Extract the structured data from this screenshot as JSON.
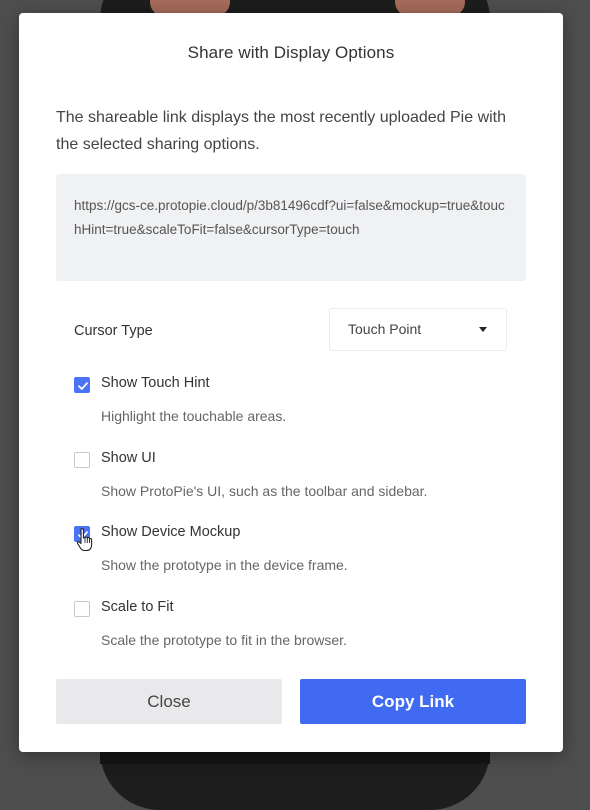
{
  "dialog": {
    "title": "Share with Display Options",
    "description": "The shareable link displays the most recently uploaded Pie with the selected sharing options.",
    "share_url": "https://gcs-ce.protopie.cloud/p/3b81496cdf?ui=false&mockup=true&touchHint=true&scaleToFit=false&cursorType=touch"
  },
  "cursor_type": {
    "label": "Cursor Type",
    "selected": "Touch Point"
  },
  "options": [
    {
      "label": "Show Touch Hint",
      "description": "Highlight the touchable areas.",
      "checked": true
    },
    {
      "label": "Show UI",
      "description": "Show ProtoPie's UI, such as the toolbar and sidebar.",
      "checked": false
    },
    {
      "label": "Show Device Mockup",
      "description": "Show the prototype in the device frame.",
      "checked": true
    },
    {
      "label": "Scale to Fit",
      "description": "Scale the prototype to fit in the browser.",
      "checked": false
    }
  ],
  "buttons": {
    "close": "Close",
    "copy_link": "Copy Link"
  },
  "colors": {
    "accent": "#4a74f5",
    "primary_button": "#3f6af1",
    "secondary_button": "#e9e9eb",
    "link_box": "#f0f1f3"
  }
}
